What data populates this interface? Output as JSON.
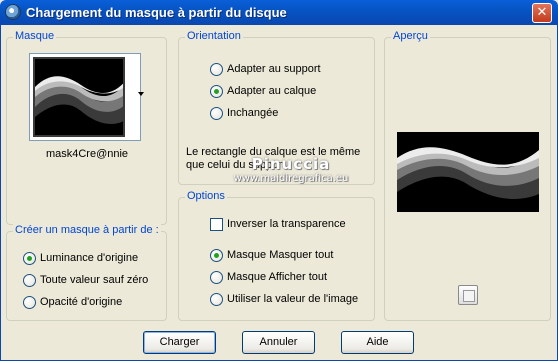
{
  "window": {
    "title": "Chargement du masque à partir du disque",
    "close_glyph": "✕"
  },
  "masque": {
    "label": "Masque",
    "file_name": "mask4Cre@nnie"
  },
  "create": {
    "label": "Créer un masque à partir de :",
    "options": [
      {
        "label": "Luminance d'origine",
        "checked": true
      },
      {
        "label": "Toute valeur sauf zéro",
        "checked": false
      },
      {
        "label": "Opacité d'origine",
        "checked": false
      }
    ]
  },
  "orientation": {
    "label": "Orientation",
    "options": [
      {
        "label": "Adapter au support",
        "checked": false
      },
      {
        "label": "Adapter au calque",
        "checked": true
      },
      {
        "label": "Inchangée",
        "checked": false
      }
    ],
    "info": "Le rectangle du calque est le même que celui du support."
  },
  "options": {
    "label": "Options",
    "invert_label": "Inverser la transparence",
    "invert_checked": false,
    "radios": [
      {
        "label": "Masque Masquer tout",
        "checked": true
      },
      {
        "label": "Masque Afficher tout",
        "checked": false
      },
      {
        "label": "Utiliser la valeur de l'image",
        "checked": false
      }
    ]
  },
  "apercu": {
    "label": "Aperçu"
  },
  "watermark": {
    "title": "Pinuccia",
    "url": "www.maidiregrafica.eu"
  },
  "buttons": {
    "load": "Charger",
    "cancel": "Annuler",
    "help": "Aide"
  },
  "icons": {
    "app": "app-icon",
    "close": "close-icon",
    "dropdown": "chevron-down-icon",
    "preview_toggle": "preview-icon"
  }
}
